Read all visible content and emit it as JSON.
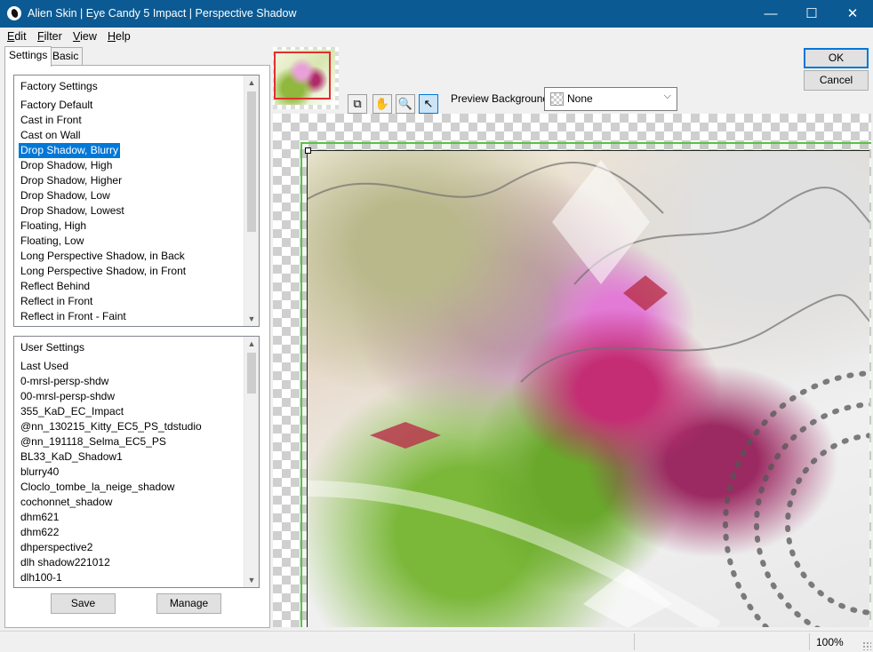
{
  "window": {
    "title": "Alien Skin | Eye Candy 5 Impact | Perspective Shadow",
    "minimize_glyph": "—",
    "maximize_glyph": "☐",
    "close_glyph": "✕"
  },
  "menu": [
    {
      "first": "E",
      "rest": "dit"
    },
    {
      "first": "F",
      "rest": "ilter"
    },
    {
      "first": "V",
      "rest": "iew"
    },
    {
      "first": "H",
      "rest": "elp"
    }
  ],
  "tabs": {
    "settings": "Settings",
    "basic": "Basic"
  },
  "factory": {
    "header": "Factory Settings",
    "items": [
      "Factory Default",
      "Cast in Front",
      "Cast on Wall",
      "Drop Shadow, Blurry",
      "Drop Shadow, High",
      "Drop Shadow, Higher",
      "Drop Shadow, Low",
      "Drop Shadow, Lowest",
      "Floating, High",
      "Floating, Low",
      "Long Perspective Shadow, in Back",
      "Long Perspective Shadow, in Front",
      "Reflect Behind",
      "Reflect in Front",
      "Reflect in Front - Faint"
    ],
    "selected": "Drop Shadow, Blurry"
  },
  "user": {
    "header": "User Settings",
    "items": [
      "Last Used",
      "0-mrsl-persp-shdw",
      "00-mrsl-persp-shdw",
      "355_KaD_EC_Impact",
      "@nn_130215_Kitty_EC5_PS_tdstudio",
      "@nn_191118_Selma_EC5_PS",
      "BL33_KaD_Shadow1",
      "blurry40",
      "Cloclo_tombe_la_neige_shadow",
      "cochonnet_shadow",
      "dhm621",
      "dhm622",
      "dhperspective2",
      "dlh shadow221012",
      "dlh100-1"
    ]
  },
  "buttons": {
    "save": "Save",
    "manage": "Manage",
    "ok": "OK",
    "cancel": "Cancel"
  },
  "toolbar": {
    "tools": [
      {
        "name": "toggle-preview-tool",
        "glyph": "⧉"
      },
      {
        "name": "hand-tool",
        "glyph": "✋"
      },
      {
        "name": "zoom-tool",
        "glyph": "🔍"
      },
      {
        "name": "select-tool",
        "glyph": "↖"
      }
    ],
    "preview_background_label": "Preview Background:",
    "preview_background_value": "None"
  },
  "status": {
    "zoom": "100%"
  },
  "colors": {
    "titlebar": "#0b5a93",
    "selection": "#0078d7"
  }
}
